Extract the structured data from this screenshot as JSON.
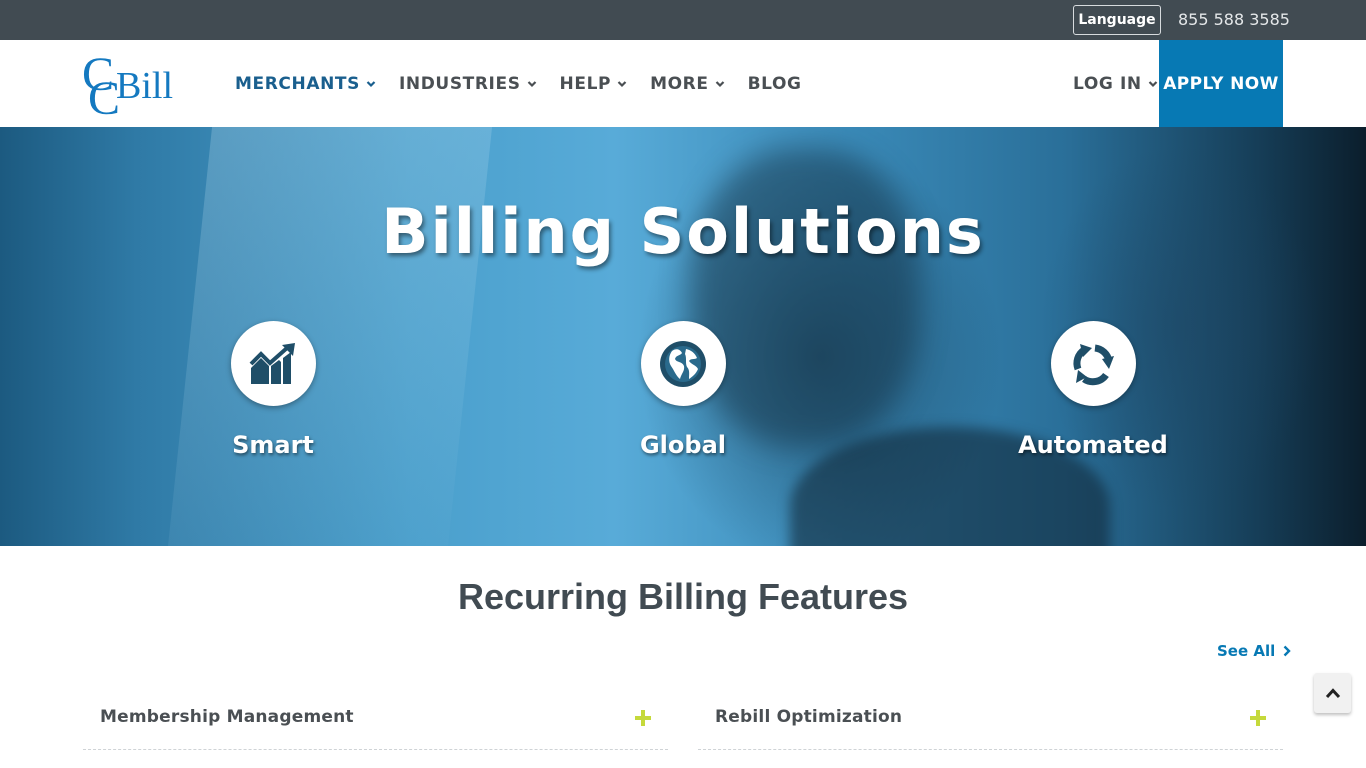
{
  "topbar": {
    "language_label": "Language",
    "phone": "855 588 3585"
  },
  "header": {
    "logo_text": "CCBill",
    "nav": [
      {
        "label": "MERCHANTS",
        "has_dropdown": true,
        "active": true
      },
      {
        "label": "INDUSTRIES",
        "has_dropdown": true,
        "active": false
      },
      {
        "label": "HELP",
        "has_dropdown": true,
        "active": false
      },
      {
        "label": "MORE",
        "has_dropdown": true,
        "active": false
      },
      {
        "label": "BLOG",
        "has_dropdown": false,
        "active": false
      }
    ],
    "login_label": "LOG IN",
    "apply_label": "APPLY NOW"
  },
  "hero": {
    "title": "Billing Solutions",
    "features": [
      {
        "label": "Smart",
        "icon": "chart-growth-icon"
      },
      {
        "label": "Global",
        "icon": "globe-icon"
      },
      {
        "label": "Automated",
        "icon": "recycle-arrows-icon"
      }
    ]
  },
  "features_section": {
    "title": "Recurring Billing Features",
    "see_all_label": "See All",
    "items": [
      {
        "label": "Membership Management"
      },
      {
        "label": "Rebill Optimization"
      }
    ]
  },
  "colors": {
    "topbar_bg": "#414b52",
    "brand_blue": "#0779b4",
    "nav_active": "#1a5f8e",
    "nav_text": "#4a4f53",
    "accent_green": "#c5d93b"
  }
}
